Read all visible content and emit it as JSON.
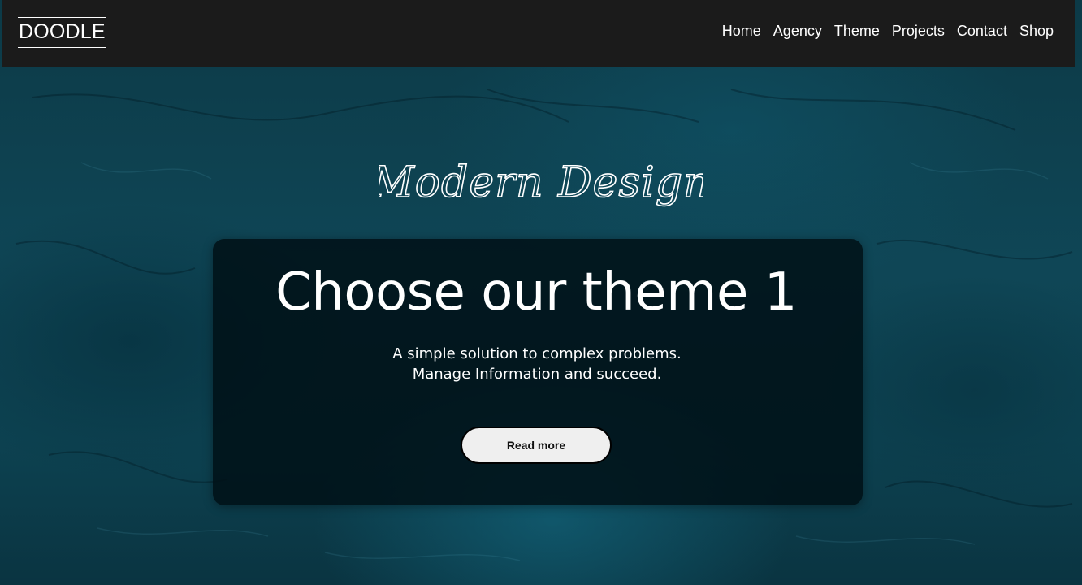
{
  "header": {
    "logo": "DOODLE",
    "nav": [
      {
        "label": "Home"
      },
      {
        "label": "Agency"
      },
      {
        "label": "Theme"
      },
      {
        "label": "Projects"
      },
      {
        "label": "Contact"
      },
      {
        "label": "Shop"
      }
    ]
  },
  "hero": {
    "script_title": "Modern Design",
    "headline": "Choose our theme 1",
    "subtitle_line1": "A simple solution to complex problems.",
    "subtitle_line2": "Manage Information and succeed.",
    "cta_label": "Read more"
  },
  "colors": {
    "topbar": "#1b1b1b",
    "background": "#0f4656",
    "panel": "#001016",
    "button": "#efefef"
  }
}
